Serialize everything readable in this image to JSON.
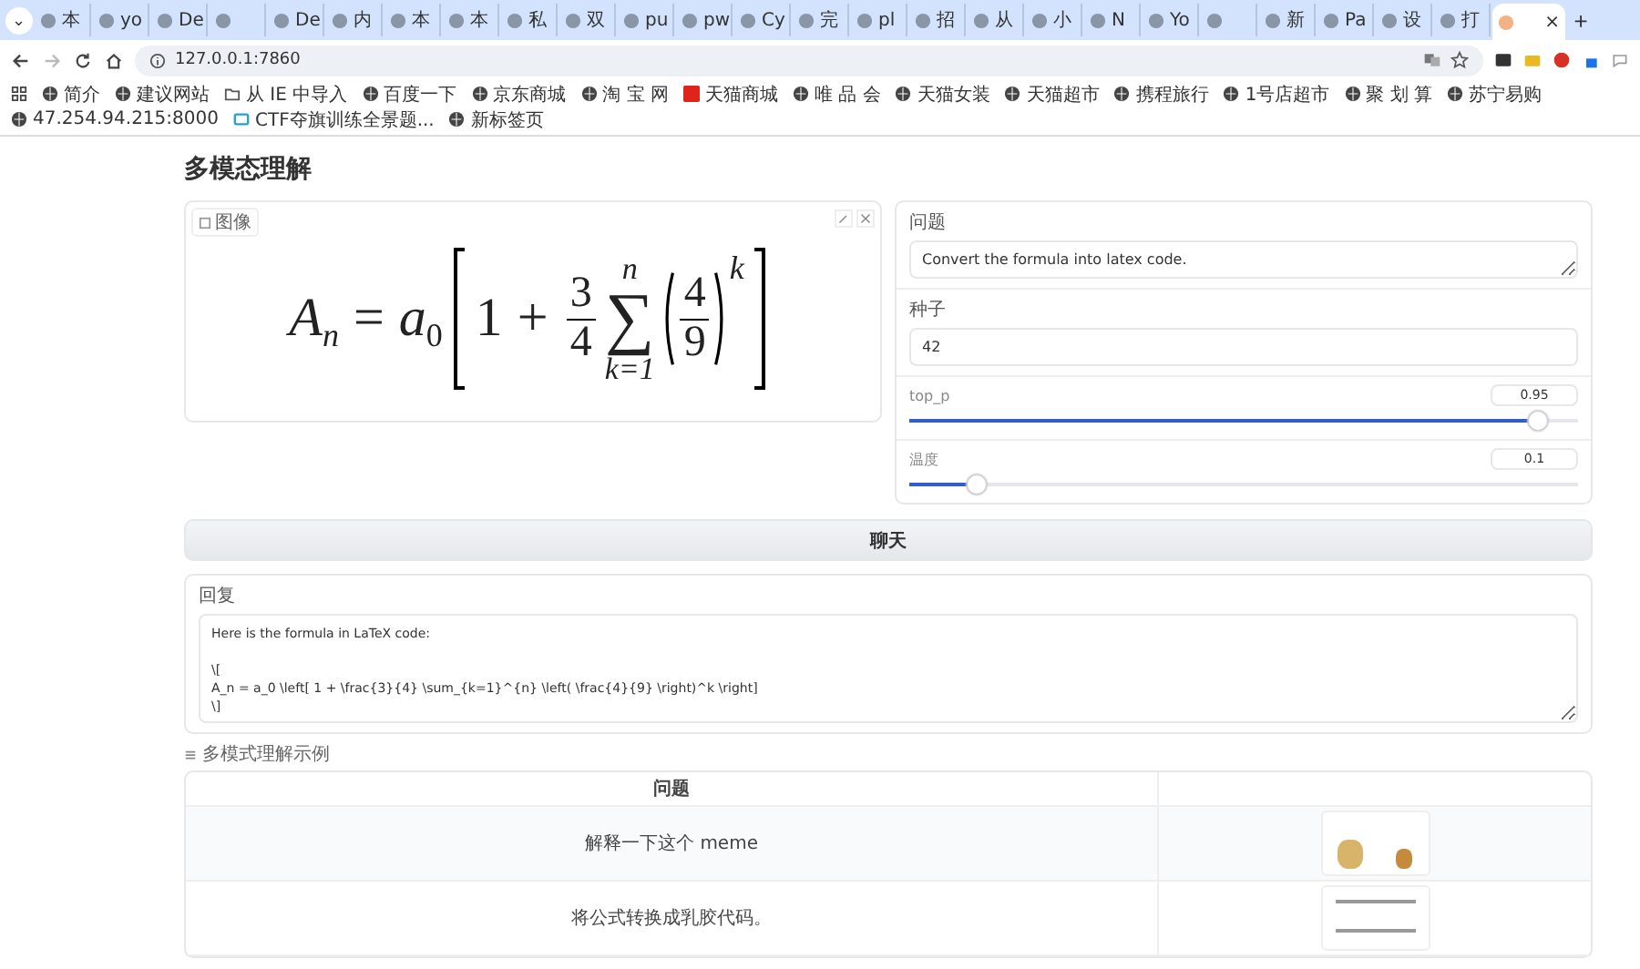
{
  "browser": {
    "tab_menu": "⌄",
    "tabs": [
      {
        "title": "本",
        "selected": false
      },
      {
        "title": "yo",
        "selected": false
      },
      {
        "title": "De",
        "selected": false
      },
      {
        "selected": false
      },
      {
        "title": "De",
        "selected": false
      },
      {
        "title": "内",
        "selected": false
      },
      {
        "title": "本",
        "selected": false
      },
      {
        "title": "本",
        "selected": false
      },
      {
        "title": "私",
        "selected": false
      },
      {
        "title": "双",
        "selected": false
      },
      {
        "title": "pu",
        "selected": false
      },
      {
        "title": "pw",
        "selected": false
      },
      {
        "title": "Cy",
        "selected": false
      },
      {
        "title": "完",
        "selected": false
      },
      {
        "title": "pl",
        "selected": false
      },
      {
        "title": "招",
        "selected": false
      },
      {
        "title": "从",
        "selected": false
      },
      {
        "title": "小",
        "selected": false
      },
      {
        "title": "N",
        "selected": false
      },
      {
        "title": "Yo",
        "selected": false
      },
      {
        "selected": false
      },
      {
        "title": "新",
        "selected": false
      },
      {
        "title": "Pa",
        "selected": false
      },
      {
        "title": "设",
        "selected": false
      },
      {
        "title": "打",
        "selected": false
      },
      {
        "selected": true,
        "close": "×"
      }
    ],
    "new_tab": "+",
    "address": "127.0.0.1:7860",
    "bookmarks": [
      {
        "label": "简介",
        "kind": "site"
      },
      {
        "label": "建议网站",
        "kind": "site"
      },
      {
        "label": "从 IE 中导入",
        "kind": "folder"
      },
      {
        "label": "百度一下",
        "kind": "site"
      },
      {
        "label": "京东商城",
        "kind": "site"
      },
      {
        "label": "淘 宝 网",
        "kind": "site"
      },
      {
        "label": "天猫商城",
        "kind": "brand"
      },
      {
        "label": "唯 品 会",
        "kind": "site"
      },
      {
        "label": "天猫女装",
        "kind": "site"
      },
      {
        "label": "天猫超市",
        "kind": "site"
      },
      {
        "label": "携程旅行",
        "kind": "site"
      },
      {
        "label": "1号店超市",
        "kind": "site"
      },
      {
        "label": "聚 划 算",
        "kind": "site"
      },
      {
        "label": "苏宁易购",
        "kind": "site"
      },
      {
        "label": "47.254.94.215:8000",
        "kind": "site"
      },
      {
        "label": "CTF夺旗训练全景题...",
        "kind": "tv"
      },
      {
        "label": "新标签页",
        "kind": "site"
      }
    ]
  },
  "page": {
    "title": "多模态理解",
    "image": {
      "label": "图像",
      "formula": {
        "lhs": "A",
        "lhs_sub": "n",
        "equals": "=",
        "coef": "a",
        "coef_sub": "0",
        "one": "1",
        "plus": "+",
        "frac": [
          "3",
          "4"
        ],
        "sum": {
          "symbol": "∑",
          "upper": "n",
          "lower": "k=1"
        },
        "inner_frac": [
          "4",
          "9"
        ],
        "power": "k"
      }
    },
    "question": {
      "label": "问题",
      "value": "Convert the formula into latex code."
    },
    "seed": {
      "label": "种子",
      "value": "42"
    },
    "sliders": [
      {
        "label": "top_p",
        "reading": "0.95",
        "level": 0.94
      },
      {
        "label": "温度",
        "reading": "0.1",
        "level": 0.1
      }
    ],
    "chat_button": "聊天",
    "answer": {
      "label": "回复",
      "value": "Here is the formula in LaTeX code:\n\n\\[\nA_n = a_0 \\left[ 1 + \\frac{3}{4} \\sum_{k=1}^{n} \\left( \\frac{4}{9} \\right)^k \\right]\n\\]"
    },
    "examples": {
      "label": "多模式理解示例",
      "columns": [
        "问题"
      ],
      "rows": [
        {
          "question": "解释一下这个 meme",
          "kind": "meme"
        },
        {
          "question": "将公式转换成乳胶代码。",
          "kind": "formula"
        }
      ]
    }
  }
}
